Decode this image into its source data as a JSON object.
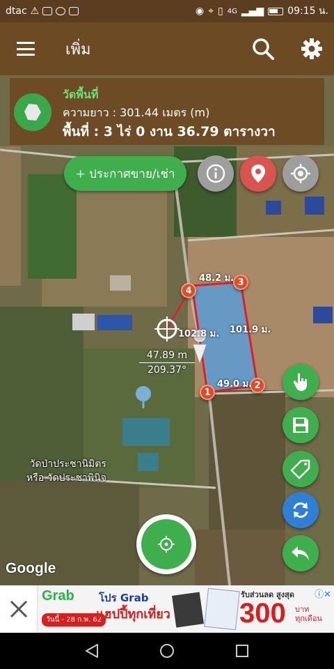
{
  "status_bar": {
    "carrier": "dtac",
    "network": "4G",
    "time": "09:15 น."
  },
  "app_bar": {
    "title": "เพิ่ม",
    "menu_icon": "hamburger-menu-icon",
    "search_icon": "search-icon",
    "settings_icon": "gear-icon"
  },
  "info_panel": {
    "heading": "วัดพื้นที่",
    "length": "ความยาว : 301.44 เมตร (m)",
    "area": "พื้นที่ : 3 ไร่ 0 งาน 36.79 ตารางวา",
    "icon": "polygon-icon"
  },
  "buttons": {
    "announce": "+ ประกาศขาย/เช่า"
  },
  "map": {
    "vertices": [
      "1",
      "2",
      "3",
      "4"
    ],
    "edges": [
      "48.2 ม.",
      "101.9 ม.",
      "49.0 ม.",
      "102.8 ม."
    ],
    "measure_distance": "47.89 m",
    "measure_bearing": "209.37°",
    "poi_line1": "วัดป่าประชานิมิตร",
    "poi_line2": "หรือ วัดประชาพินิจ",
    "attribution": "Google",
    "polygon_color": "#e02020",
    "fill_color": "#5b9bd5"
  },
  "ad": {
    "brand": "Grab",
    "line1": "โปร Grab",
    "line2": "แฮปปี้ทุกเที่ยว",
    "date_tag": "วันนี้ - 28 ก.พ. 62",
    "sale_label": "รับส่วนลด สูงสุด",
    "amount": "300",
    "unit1": "บาท",
    "unit2": "ทุกเดือน"
  },
  "colors": {
    "app_bar": "#6b4a24",
    "accent_green": "#3fae4c",
    "accent_red": "#d9534f",
    "accent_blue": "#2f7fd4"
  }
}
